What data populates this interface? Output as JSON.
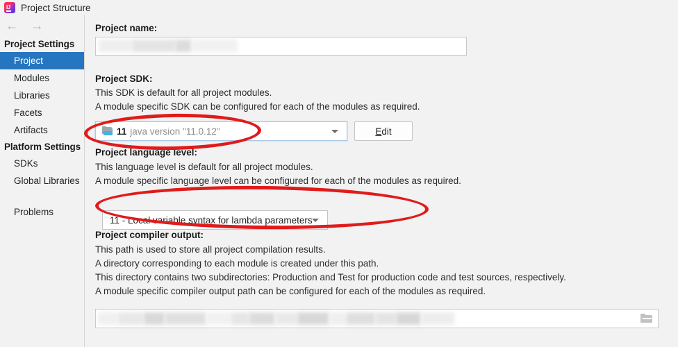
{
  "window": {
    "title": "Project Structure",
    "app_icon": "intellij-idea-icon",
    "back_arrow": "←",
    "forward_arrow": "→"
  },
  "sidebar": {
    "groups": [
      {
        "label": "Project Settings",
        "items": [
          {
            "label": "Project",
            "selected": true
          },
          {
            "label": "Modules",
            "selected": false
          },
          {
            "label": "Libraries",
            "selected": false
          },
          {
            "label": "Facets",
            "selected": false
          },
          {
            "label": "Artifacts",
            "selected": false
          }
        ]
      },
      {
        "label": "Platform Settings",
        "items": [
          {
            "label": "SDKs",
            "selected": false
          },
          {
            "label": "Global Libraries",
            "selected": false
          }
        ]
      }
    ],
    "problems_label": "Problems"
  },
  "main": {
    "project_name": {
      "label": "Project name:",
      "value": "",
      "redacted": true
    },
    "project_sdk": {
      "label": "Project SDK:",
      "description_lines": [
        "This SDK is default for all project modules.",
        "A module specific SDK can be configured for each of the modules as required."
      ],
      "selected_version": "11",
      "selected_description": "java version \"11.0.12\"",
      "sdk_icon": "java-sdk-folder-icon",
      "dropdown_arrow": "chevron-down-icon",
      "edit_button_label": "Edit",
      "edit_button_mnemonic": "E",
      "edit_button_rest": "dit"
    },
    "project_language_level": {
      "label": "Project language level:",
      "description_lines": [
        "This language level is default for all project modules.",
        "A module specific language level can be configured for each of the modules as required."
      ],
      "selected_value": "11 - Local variable syntax for lambda parameters",
      "dropdown_arrow": "chevron-down-icon"
    },
    "project_compiler_output": {
      "label": "Project compiler output:",
      "description_lines": [
        "This path is used to store all project compilation results.",
        "A directory corresponding to each module is created under this path.",
        "This directory contains two subdirectories: Production and Test for production code and test sources, respectively.",
        "A module specific compiler output path can be configured for each of the modules as required."
      ],
      "value": "",
      "redacted": true,
      "browse_icon": "folder-browse-icon"
    }
  },
  "annotations": {
    "color": "#e01b1b",
    "shapes": [
      {
        "name": "sdk-combo-highlight",
        "target": "project-sdk-combo"
      },
      {
        "name": "language-level-combo-highlight",
        "target": "language-level-combo"
      }
    ]
  },
  "colors": {
    "window_background": "#f2f2f2",
    "selection_blue": "#2675c0",
    "annotation_red": "#e01b1b",
    "field_white": "#ffffff",
    "muted_text": "#8d8d8d"
  }
}
